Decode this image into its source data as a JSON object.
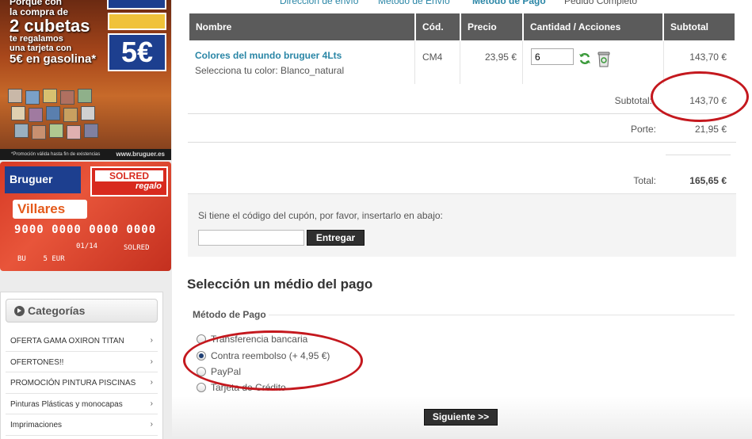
{
  "banner_top": {
    "lines": [
      "Porque con",
      "la compra de",
      "2 cubetas",
      "te regalamos",
      "una tarjeta con",
      "5€ en gasolina*"
    ],
    "euro_badge": "5€",
    "footnote": "*Promoción válida hasta fin de existencias",
    "brand_url": "www.bruguer.es"
  },
  "banner_card": {
    "brand": "Bruguer",
    "solred": "SOLRED",
    "regalo": "regalo",
    "villares": "Villares",
    "card_number": "9000 0000 0000 0000",
    "expiry": "01/14",
    "bu": "BU",
    "amount": "5 EUR",
    "issuer": "SOLRED"
  },
  "categories": {
    "title": "Categorías",
    "items": [
      "OFERTA GAMA OXIRON TITAN",
      "OFERTONES!!",
      "PROMOCIÓN PINTURA PISCINAS",
      "Pinturas Plásticas y monocapas",
      "Imprimaciones"
    ]
  },
  "steps": [
    "Dirección de envío",
    "Método de Envío",
    "Método de Pago",
    "Pedido Completo"
  ],
  "cart": {
    "headers": [
      "Nombre",
      "Cód.",
      "Precio",
      "Cantidad / Acciones",
      "Subtotal"
    ],
    "product_name": "Colores del mundo bruguer 4Lts",
    "product_option": "Selecciona tu color: Blanco_natural",
    "code": "CM4",
    "price": "23,95 €",
    "quantity": "6",
    "line_subtotal": "143,70 €",
    "subtotal_label": "Subtotal:",
    "subtotal_value": "143,70 €",
    "shipping_label": "Porte:",
    "shipping_value": "21,95 €",
    "total_label": "Total:",
    "total_value": "165,65 €"
  },
  "coupon": {
    "text": "Si tiene el código del cupón, por favor, insertarlo en abajo:",
    "button": "Entregar"
  },
  "payment": {
    "title": "Selección un médio del pago",
    "legend": "Método de Pago",
    "options": [
      "Transferencia bancaria",
      "Contra reembolso (+ 4,95 €)",
      "PayPal",
      "Tarjeta de Crédito"
    ],
    "selected_index": 1,
    "next_button": "Siguiente >>"
  },
  "colors": {
    "accent_link": "#2a86a6",
    "header_bg": "#5b5b5b",
    "annotation_red": "#c4181e"
  }
}
